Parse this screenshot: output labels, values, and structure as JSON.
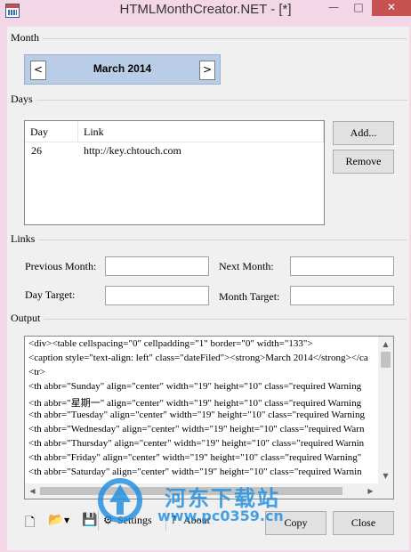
{
  "window": {
    "title": "HTMLMonthCreator.NET - [*]",
    "min_glyph": "—",
    "max_glyph": "□",
    "close_glyph": "✕"
  },
  "month": {
    "section_label": "Month",
    "value": "March 2014",
    "prev": "<",
    "next": ">"
  },
  "days": {
    "section_label": "Days",
    "columns": [
      "Day",
      "Link"
    ],
    "rows": [
      {
        "day": "26",
        "link": "http://key.chtouch.com"
      }
    ],
    "add_label": "Add...",
    "remove_label": "Remove"
  },
  "links": {
    "section_label": "Links",
    "previous_month_label": "Previous Month:",
    "next_month_label": "Next Month:",
    "day_target_label": "Day Target:",
    "month_target_label": "Month Target:",
    "previous_month_value": "",
    "next_month_value": "",
    "day_target_value": "",
    "month_target_value": ""
  },
  "output": {
    "section_label": "Output",
    "lines": [
      "<div><table cellspacing=\"0\" cellpadding=\"1\" border=\"0\" width=\"133\">",
      "<caption style=\"text-align: left\" class=\"dateFiled\"><strong>March 2014</strong></ca",
      "<tr>",
      "<th abbr=\"Sunday\" align=\"center\" width=\"19\" height=\"10\" class=\"required Warning",
      "<th abbr=\"星期一\" align=\"center\" width=\"19\" height=\"10\" class=\"required Warning",
      "<th abbr=\"Tuesday\" align=\"center\" width=\"19\" height=\"10\" class=\"required Warning",
      "<th abbr=\"Wednesday\" align=\"center\" width=\"19\" height=\"10\" class=\"required Warn",
      "<th abbr=\"Thursday\" align=\"center\" width=\"19\" height=\"10\" class=\"required Warnin",
      "<th abbr=\"Friday\" align=\"center\" width=\"19\" height=\"10\" class=\"required Warning\"",
      "<th abbr=\"Saturday\" align=\"center\" width=\"19\" height=\"10\" class=\"required Warnin"
    ]
  },
  "toolbar": {
    "settings_label": "Settings",
    "about_label": "About",
    "copy_label": "Copy",
    "close_label": "Close"
  },
  "watermark": {
    "text": "河东下载站",
    "url": "www.pc0359.cn"
  }
}
